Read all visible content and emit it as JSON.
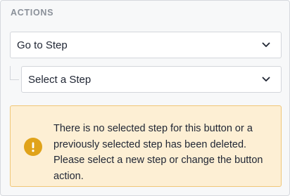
{
  "actions": {
    "section_title": "ACTIONS",
    "action_select": {
      "selected": "Go to Step"
    },
    "step_select": {
      "selected": "Select a Step"
    },
    "warning": {
      "message": "There is no selected step for this button or a previously selected step has been deleted. Please select a new step or change the button action.",
      "icon": "exclamation-icon"
    }
  },
  "colors": {
    "panel_bg": "#f7f8f9",
    "warning_bg": "#fdefd4",
    "warning_border": "#f0c778",
    "warning_icon": "#e0a31a",
    "section_title": "#8a9099"
  }
}
